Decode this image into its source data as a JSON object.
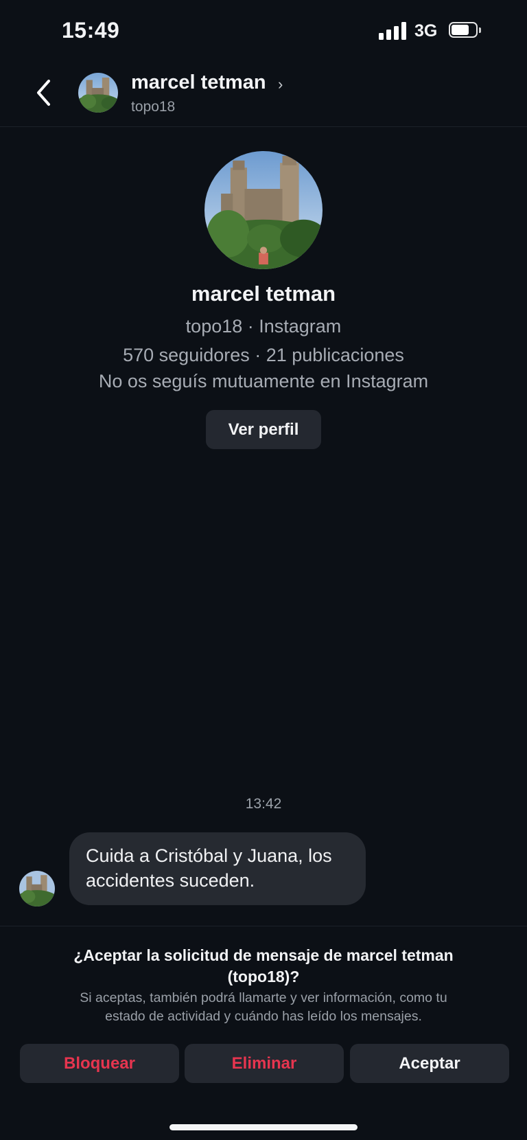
{
  "status_bar": {
    "time": "15:49",
    "network": "3G"
  },
  "header": {
    "name": "marcel tetman",
    "chevron": "›",
    "username": "topo18"
  },
  "profile": {
    "name": "marcel tetman",
    "subtitle": "topo18 · Instagram",
    "stats": "570 seguidores · 21 publicaciones",
    "follow_status": "No os seguís mutuamente en Instagram",
    "view_profile_label": "Ver perfil"
  },
  "conversation": {
    "timestamp": "13:42",
    "message_line1": "Cuida a Cristóbal y Juana, los",
    "message_line2": "accidentes suceden."
  },
  "request": {
    "title_line1": "¿Aceptar la solicitud de mensaje de marcel tetman",
    "title_line2": "(topo18)?",
    "desc_line1": "Si aceptas, también podrá llamarte y ver información, como tu",
    "desc_line2": "estado de actividad y cuándo has leído los mensajes.",
    "block_label": "Bloquear",
    "delete_label": "Eliminar",
    "accept_label": "Aceptar"
  },
  "colors": {
    "background": "#0c1016",
    "button_bg": "#242830",
    "bubble_bg": "#262a31",
    "danger": "#e6354f"
  },
  "icons": [
    "back-chevron-icon",
    "signal-icon",
    "battery-icon",
    "chevron-right-icon"
  ]
}
